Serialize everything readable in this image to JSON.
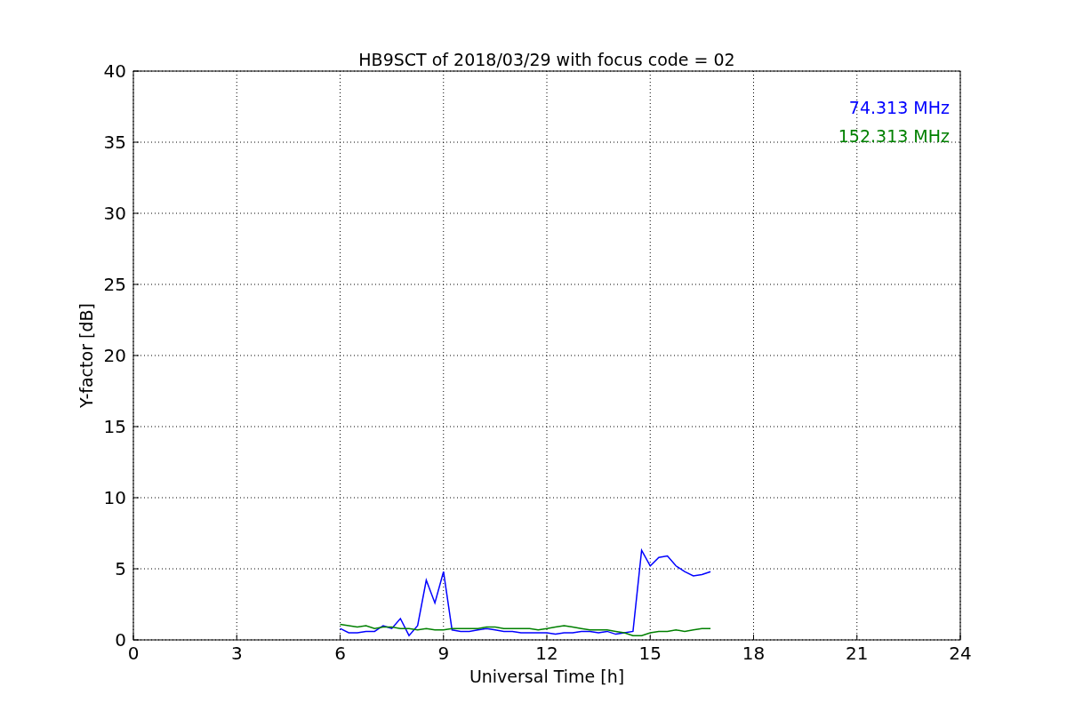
{
  "chart_data": {
    "type": "line",
    "title": "HB9SCT of 2018/03/29 with focus code = 02",
    "xlabel": "Universal Time [h]",
    "ylabel": "Y-factor [dB]",
    "grid": true,
    "xlim": [
      0,
      24
    ],
    "ylim": [
      0,
      40
    ],
    "xticks": [
      0,
      3,
      6,
      9,
      12,
      15,
      18,
      21,
      24
    ],
    "yticks": [
      0,
      5,
      10,
      15,
      20,
      25,
      30,
      35,
      40
    ],
    "x": [
      6,
      6.25,
      6.5,
      6.75,
      7,
      7.25,
      7.5,
      7.75,
      8,
      8.25,
      8.5,
      8.75,
      9,
      9.25,
      9.5,
      9.75,
      10,
      10.25,
      10.5,
      10.75,
      11,
      11.25,
      11.5,
      11.75,
      12,
      12.25,
      12.5,
      12.75,
      13,
      13.25,
      13.5,
      13.75,
      14,
      14.25,
      14.5,
      14.75,
      15,
      15.25,
      15.5,
      15.75,
      16,
      16.25,
      16.5,
      16.75
    ],
    "series": [
      {
        "name": "74.313 MHz",
        "color": "#0000ff",
        "values": [
          0.8,
          0.5,
          0.5,
          0.6,
          0.6,
          1.0,
          0.8,
          1.5,
          0.3,
          1.0,
          4.2,
          2.6,
          4.8,
          0.7,
          0.6,
          0.6,
          0.7,
          0.8,
          0.7,
          0.6,
          0.6,
          0.5,
          0.5,
          0.5,
          0.5,
          0.4,
          0.5,
          0.5,
          0.6,
          0.6,
          0.5,
          0.6,
          0.4,
          0.5,
          0.6,
          6.3,
          5.2,
          5.8,
          5.9,
          5.2,
          4.8,
          4.5,
          4.6,
          4.8
        ]
      },
      {
        "name": "152.313 MHz",
        "color": "#008000",
        "values": [
          1.1,
          1.0,
          0.9,
          1.0,
          0.8,
          0.9,
          0.9,
          0.8,
          0.8,
          0.7,
          0.8,
          0.7,
          0.7,
          0.8,
          0.8,
          0.8,
          0.8,
          0.9,
          0.9,
          0.8,
          0.8,
          0.8,
          0.8,
          0.7,
          0.8,
          0.9,
          1.0,
          0.9,
          0.8,
          0.7,
          0.7,
          0.7,
          0.6,
          0.5,
          0.3,
          0.3,
          0.5,
          0.6,
          0.6,
          0.7,
          0.6,
          0.7,
          0.8,
          0.8
        ]
      }
    ]
  }
}
